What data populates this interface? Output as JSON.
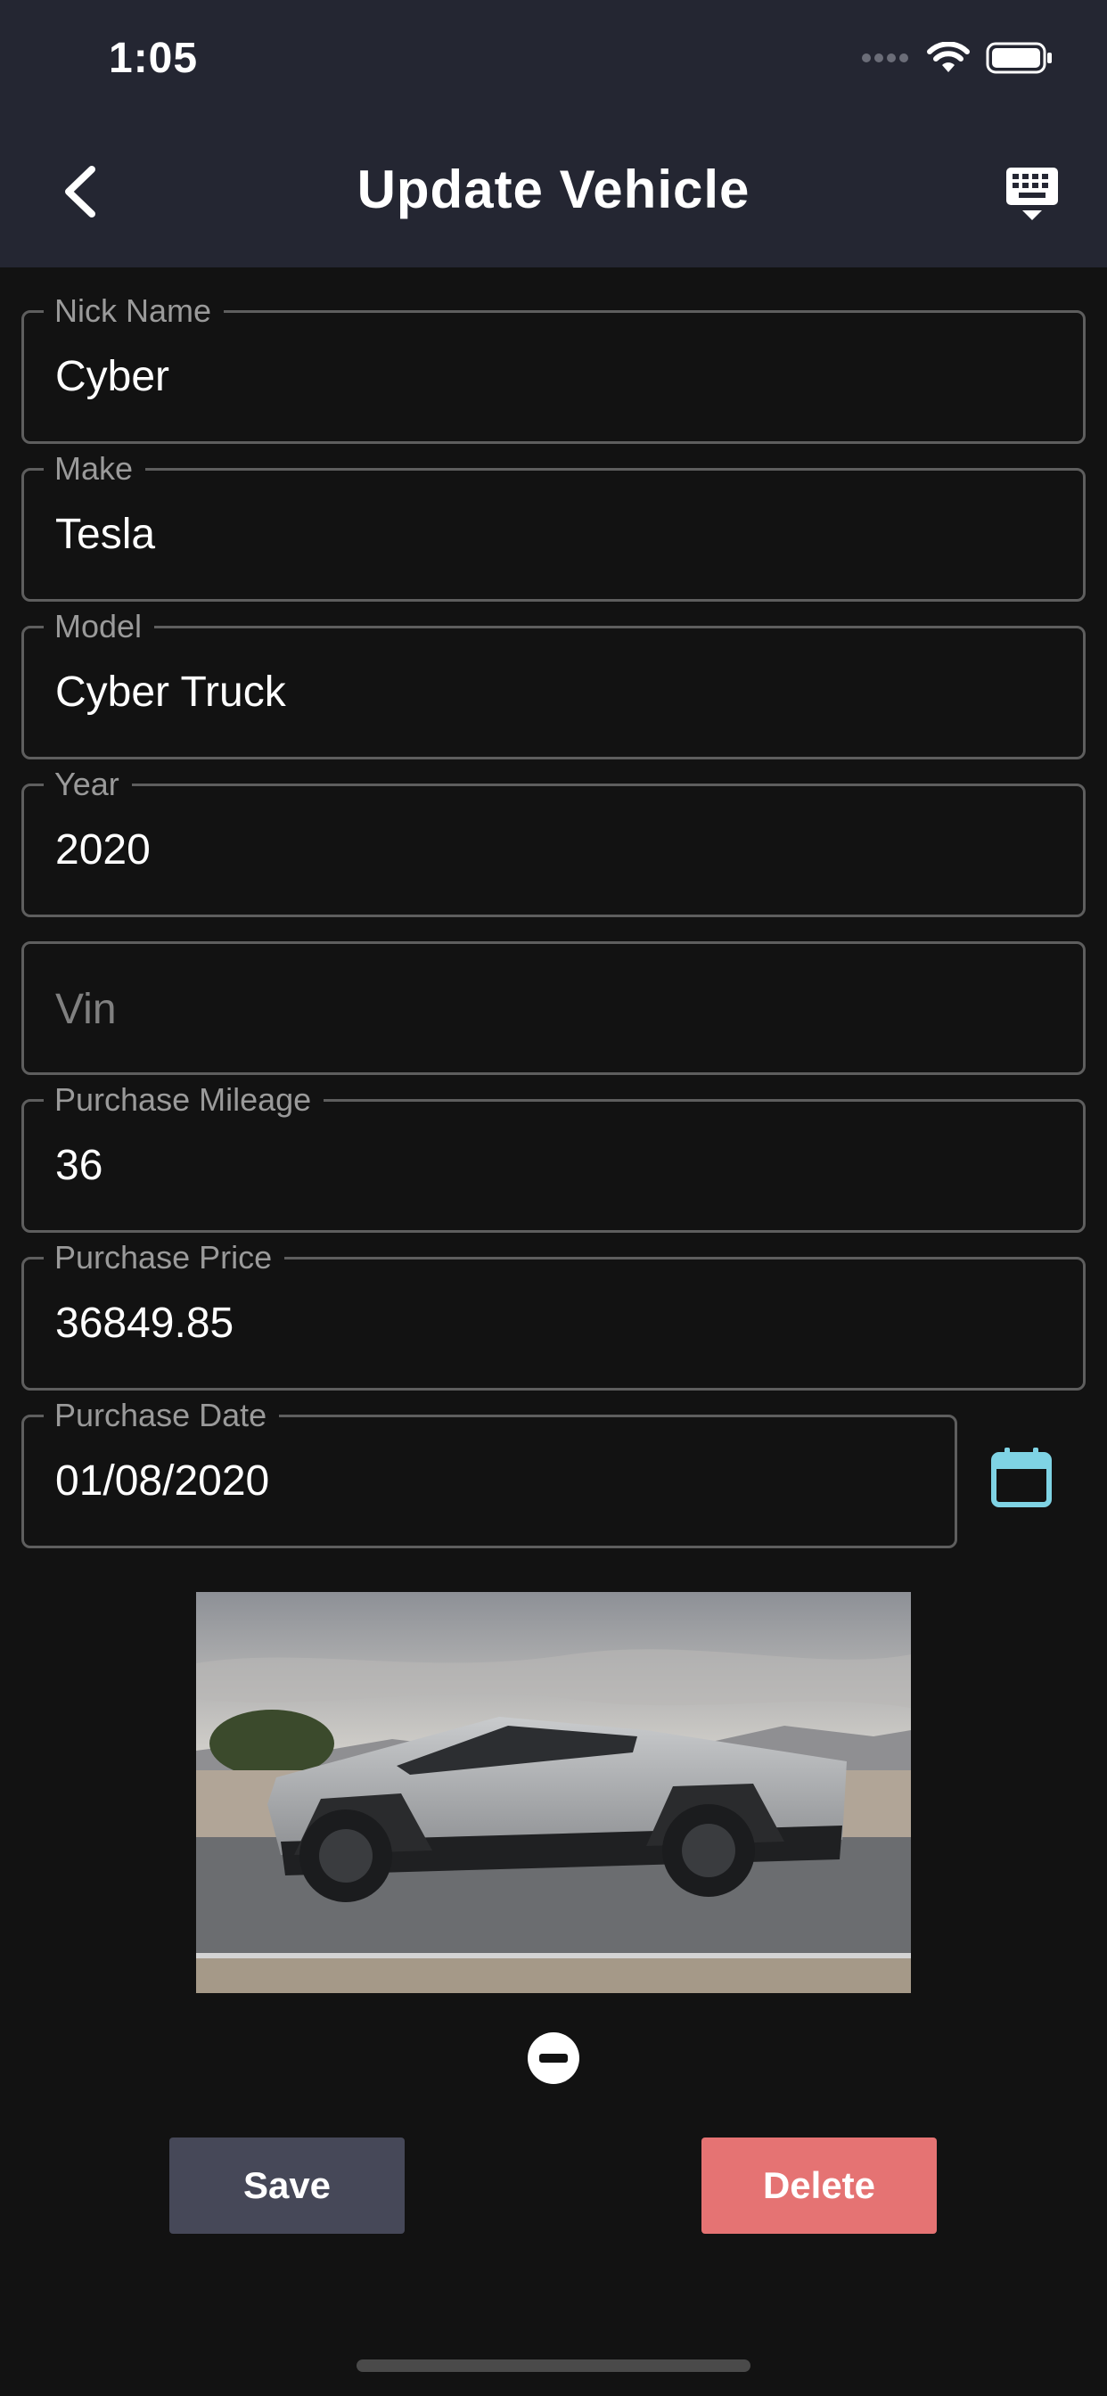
{
  "status_bar": {
    "time": "1:05"
  },
  "nav": {
    "title": "Update Vehicle"
  },
  "form": {
    "nick_name": {
      "label": "Nick Name",
      "value": "Cyber"
    },
    "make": {
      "label": "Make",
      "value": "Tesla"
    },
    "model": {
      "label": "Model",
      "value": "Cyber Truck"
    },
    "year": {
      "label": "Year",
      "value": "2020"
    },
    "vin": {
      "placeholder": "Vin",
      "value": ""
    },
    "purchase_mileage": {
      "label": "Purchase Mileage",
      "value": "36"
    },
    "purchase_price": {
      "label": "Purchase Price",
      "value": "36849.85"
    },
    "purchase_date": {
      "label": "Purchase Date",
      "value": "01/08/2020"
    }
  },
  "actions": {
    "save_label": "Save",
    "delete_label": "Delete"
  },
  "colors": {
    "nav_background": "#242632",
    "page_background": "#121212",
    "save_button": "#464858",
    "delete_button": "#e57373",
    "calendar_accent": "#7fd3e4"
  },
  "icons": [
    "back-chevron-icon",
    "keyboard-hide-icon",
    "calendar-icon",
    "remove-circle-icon",
    "wifi-icon",
    "battery-icon",
    "signal-icon"
  ]
}
